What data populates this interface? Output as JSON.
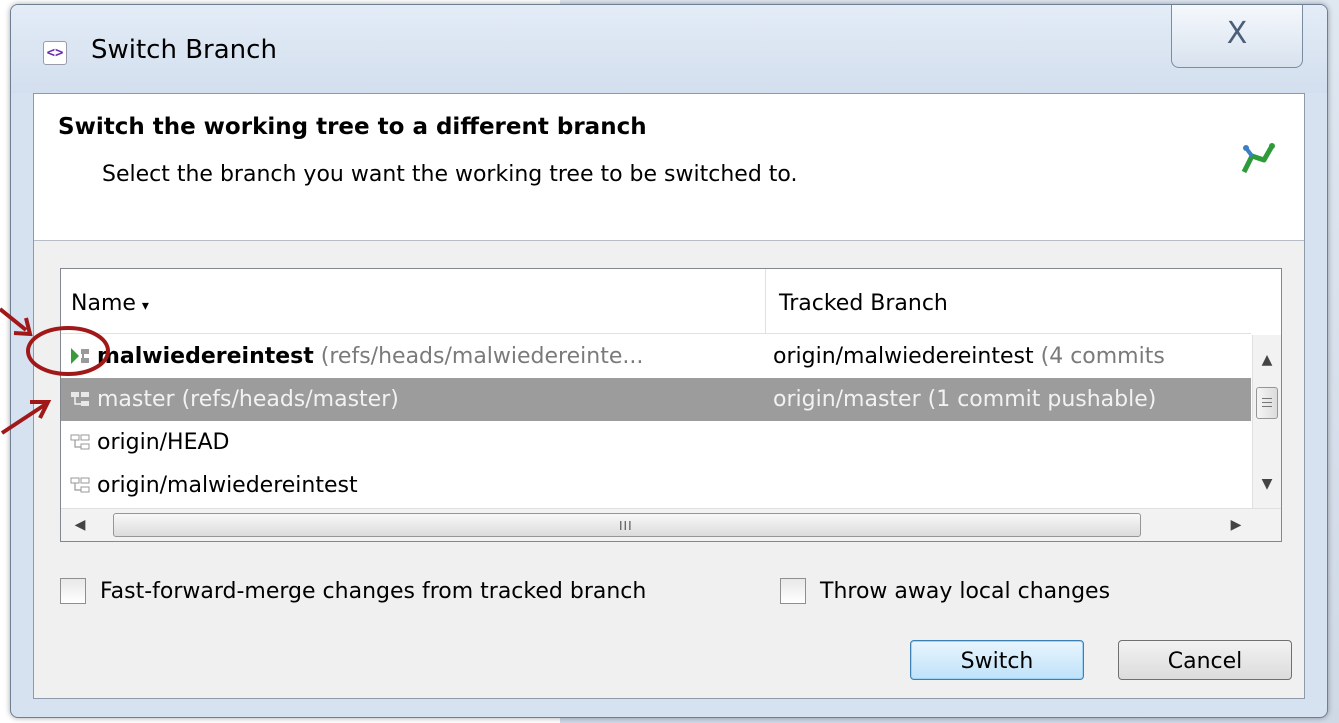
{
  "dialog": {
    "title": "Switch Branch",
    "title_icon_glyph": "<>",
    "close_glyph": "X"
  },
  "header": {
    "title": "Switch the working tree to a different branch",
    "subtitle": "Select the branch you want the working tree to be switched to."
  },
  "table": {
    "columns": {
      "name": "Name",
      "sort_indicator": "▾",
      "tracked": "Tracked Branch"
    },
    "rows": [
      {
        "name": "malwiedereintest",
        "ref": " (refs/heads/malwiedereinte...",
        "tracked": "origin/malwiedereintest",
        "tracked_extra": " (4 commits",
        "current": true,
        "selected": false
      },
      {
        "name": "master",
        "ref": " (refs/heads/master)",
        "tracked": "origin/master",
        "tracked_extra": " (1 commit pushable)",
        "current": false,
        "selected": true
      },
      {
        "name": "origin/HEAD",
        "ref": "",
        "tracked": "",
        "tracked_extra": "",
        "current": false,
        "selected": false
      },
      {
        "name": "origin/malwiedereintest",
        "ref": "",
        "tracked": "",
        "tracked_extra": "",
        "current": false,
        "selected": false
      }
    ],
    "hscroll_grip": "III"
  },
  "options": {
    "fast_forward": "Fast-forward-merge changes from tracked branch",
    "throw_away": "Throw away local changes"
  },
  "buttons": {
    "switch": "Switch",
    "cancel": "Cancel"
  },
  "colors": {
    "annotation": "#a01818",
    "selection": "#9c9c9c",
    "accent_button": "#3c7fb1"
  }
}
